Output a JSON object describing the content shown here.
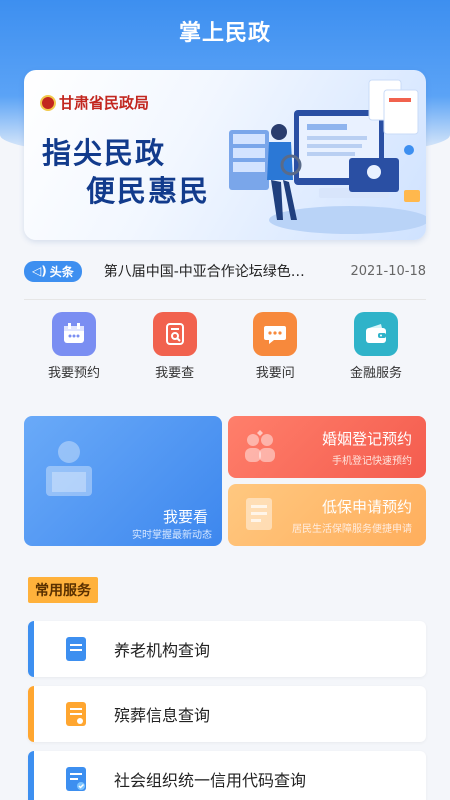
{
  "header": {
    "title": "掌上民政"
  },
  "banner": {
    "org": "甘肃省民政局",
    "line1": "指尖民政",
    "line2": "便民惠民"
  },
  "news": {
    "tag": "头条",
    "text": "第八届中国-中亚合作论坛绿色发…",
    "date": "2021-10-18"
  },
  "grid": [
    {
      "label": "我要预约",
      "icon": "calendar-icon",
      "color": "#7a8ef2"
    },
    {
      "label": "我要查",
      "icon": "search-doc-icon",
      "color": "#f1624e"
    },
    {
      "label": "我要问",
      "icon": "chat-icon",
      "color": "#f7893c"
    },
    {
      "label": "金融服务",
      "icon": "wallet-icon",
      "color": "#2fb3c9"
    }
  ],
  "cards": {
    "big": {
      "title": "我要看",
      "subtitle": "实时掌握最新动态"
    },
    "marriage": {
      "title": "婚姻登记预约",
      "subtitle": "手机登记快速预约"
    },
    "subsistence": {
      "title": "低保申请预约",
      "subtitle": "居民生活保障服务便捷申请"
    }
  },
  "section": {
    "title": "常用服务"
  },
  "services": [
    {
      "label": "养老机构查询",
      "accent": "#3d8ff0",
      "icon": "document-icon"
    },
    {
      "label": "殡葬信息查询",
      "accent": "#ffa630",
      "icon": "document-list-icon"
    },
    {
      "label": "社会组织统一信用代码查询",
      "accent": "#3d8ff0",
      "icon": "document-check-icon"
    }
  ]
}
